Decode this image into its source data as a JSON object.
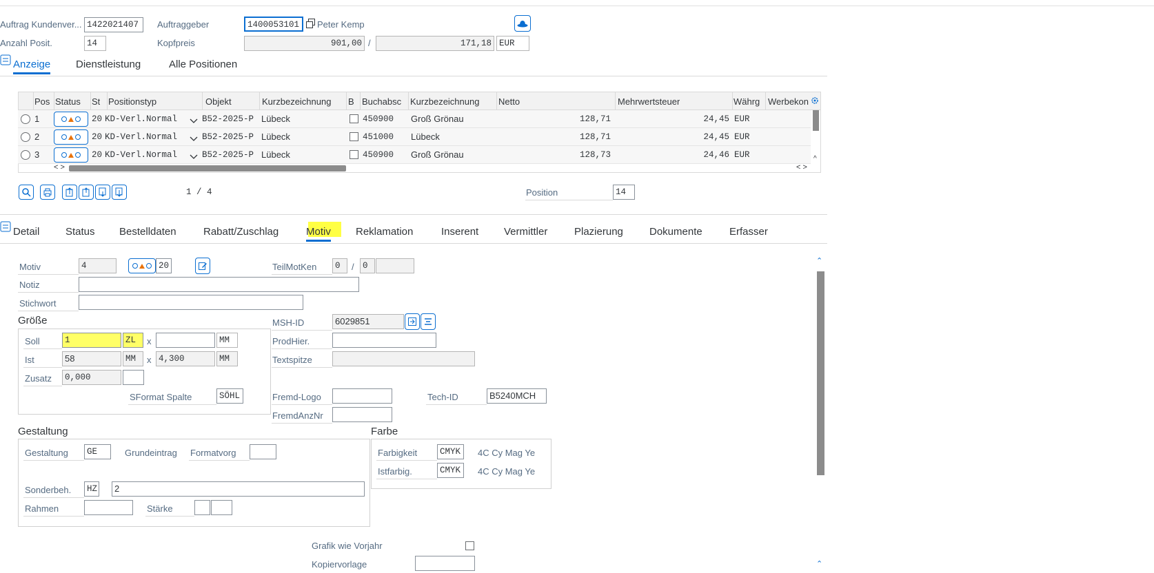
{
  "header": {
    "order_label": "Auftrag Kundenver...",
    "order_value": "1422021407",
    "client_label": "Auftraggeber",
    "client_value": "1400053101",
    "client_name": "Peter Kemp",
    "positions_label": "Anzahl Posit.",
    "positions_value": "14",
    "headprice_label": "Kopfpreis",
    "headprice_value": "901,00",
    "headprice_sep": "/",
    "headprice_tax": "171,18",
    "currency": "EUR"
  },
  "top_tabs": [
    "Anzeige",
    "Dienstleistung",
    "Alle Positionen"
  ],
  "table": {
    "columns": [
      "Pos",
      "Status",
      "St",
      "Positionstyp",
      "Objekt",
      "Kurzbezeichnung",
      "B",
      "Buchabsc",
      "Kurzbezeichnung",
      "Netto",
      "Mehrwertsteuer",
      "Währg",
      "Werbekon"
    ],
    "rows": [
      {
        "pos": "1",
        "st": "20",
        "type": "KD-Verl.Normal",
        "objekt": "B52-2025-P",
        "kurz": "Lübeck",
        "buch": "450900",
        "kurz2": "Groß Grönau",
        "netto": "128,71",
        "mwst": "24,45",
        "waehrg": "EUR"
      },
      {
        "pos": "2",
        "st": "20",
        "type": "KD-Verl.Normal",
        "objekt": "B52-2025-P",
        "kurz": "Lübeck",
        "buch": "451000",
        "kurz2": "Lübeck",
        "netto": "128,71",
        "mwst": "24,45",
        "waehrg": "EUR"
      },
      {
        "pos": "3",
        "st": "20",
        "type": "KD-Verl.Normal",
        "objekt": "B52-2025-P",
        "kurz": "Lübeck",
        "buch": "450900",
        "kurz2": "Groß Grönau",
        "netto": "128,73",
        "mwst": "24,46",
        "waehrg": "EUR"
      }
    ],
    "pager": "1 / 4",
    "position_label": "Position",
    "position_value": "14"
  },
  "detail_tabs": [
    "Detail",
    "Status",
    "Bestelldaten",
    "Rabatt/Zuschlag",
    "Motiv",
    "Reklamation",
    "Inserent",
    "Vermittler",
    "Plazierung",
    "Dokumente",
    "Erfasser"
  ],
  "motiv": {
    "motiv_label": "Motiv",
    "motiv_value": "4",
    "status_value": "20",
    "teilmotken_label": "TeilMotKen",
    "teilmotken_a": "0",
    "teilmotken_sep": "/",
    "teilmotken_b": "0",
    "notiz_label": "Notiz",
    "stichwort_label": "Stichwort",
    "groesse_title": "Größe",
    "soll_label": "Soll",
    "soll_value": "1",
    "soll_unit": "ZL",
    "soll_x": "x",
    "soll_unit2": "MM",
    "ist_label": "Ist",
    "ist_value": "58",
    "ist_unit": "MM",
    "ist_x": "x",
    "ist_value2": "4,300",
    "ist_unit2": "MM",
    "zusatz_label": "Zusatz",
    "zusatz_value": "0,000",
    "sformat_label": "SFormat Spalte",
    "sformat_value": "SÖHL",
    "msh_label": "MSH-ID",
    "msh_value": "6029851",
    "prodhier_label": "ProdHier.",
    "textspitze_label": "Textspitze",
    "fremdlogo_label": "Fremd-Logo",
    "fremdanz_label": "FremdAnzNr",
    "techid_label": "Tech-ID",
    "techid_value": "B5240MCH",
    "gestaltung_title": "Gestaltung",
    "gestaltung_label": "Gestaltung",
    "gestaltung_value": "GE",
    "grundeintrag_label": "Grundeintrag",
    "formatvorg_label": "Formatvorg",
    "sonderbeh_label": "Sonderbeh.",
    "sonderbeh_code": "HZ",
    "sonderbeh_value": "2",
    "rahmen_label": "Rahmen",
    "staerke_label": "Stärke",
    "farbe_title": "Farbe",
    "farbigkeit_label": "Farbigkeit",
    "farbigkeit_value": "CMYK",
    "farbigkeit_desc": "4C Cy Mag Ye",
    "istfarbig_label": "Istfarbig.",
    "istfarbig_value": "CMYK",
    "istfarbig_desc": "4C Cy Mag Ye",
    "grafik_label": "Grafik wie Vorjahr",
    "kopier_label": "Kopiervorlage"
  },
  "colors": {
    "accent": "#0a6ed1",
    "highlight": "#ffff44",
    "warning": "#e9730c"
  }
}
